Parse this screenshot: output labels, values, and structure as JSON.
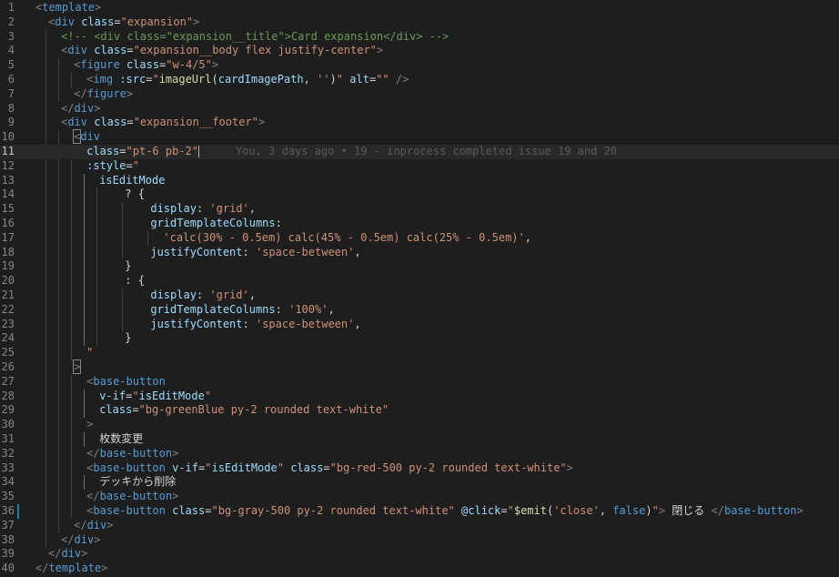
{
  "editor": {
    "lines": [
      {
        "n": "1",
        "segments": [
          [
            "br",
            "<"
          ],
          [
            "tag",
            "template"
          ],
          [
            "br",
            ">"
          ]
        ]
      },
      {
        "n": "2",
        "segments": [
          [
            "br",
            "<"
          ],
          [
            "tag",
            "div"
          ],
          [
            "txt",
            " "
          ],
          [
            "attr",
            "class"
          ],
          [
            "txt",
            "="
          ],
          [
            "str",
            "\"expansion\""
          ],
          [
            "br",
            ">"
          ]
        ]
      },
      {
        "n": "3",
        "segments": [
          [
            "cmt",
            "<!-- <div class=\"expansion__title\">Card expansion</div> -->"
          ]
        ]
      },
      {
        "n": "4",
        "segments": [
          [
            "br",
            "<"
          ],
          [
            "tag",
            "div"
          ],
          [
            "txt",
            " "
          ],
          [
            "attr",
            "class"
          ],
          [
            "txt",
            "="
          ],
          [
            "str",
            "\"expansion__body flex justify-center\""
          ],
          [
            "br",
            ">"
          ]
        ]
      },
      {
        "n": "5",
        "segments": [
          [
            "br",
            "<"
          ],
          [
            "tag",
            "figure"
          ],
          [
            "txt",
            " "
          ],
          [
            "attr",
            "class"
          ],
          [
            "txt",
            "="
          ],
          [
            "str",
            "\"w-4/5\""
          ],
          [
            "br",
            ">"
          ]
        ]
      },
      {
        "n": "6",
        "segments": [
          [
            "br",
            "<"
          ],
          [
            "tag",
            "img"
          ],
          [
            "txt",
            " "
          ],
          [
            "attr",
            ":src"
          ],
          [
            "txt",
            "="
          ],
          [
            "str",
            "\""
          ],
          [
            "fn",
            "imageUrl"
          ],
          [
            "txt",
            "("
          ],
          [
            "key",
            "cardImagePath"
          ],
          [
            "txt",
            ", "
          ],
          [
            "str",
            "''"
          ],
          [
            "txt",
            ")"
          ],
          [
            "str",
            "\""
          ],
          [
            "txt",
            " "
          ],
          [
            "attr",
            "alt"
          ],
          [
            "txt",
            "="
          ],
          [
            "str",
            "\"\""
          ],
          [
            "txt",
            " "
          ],
          [
            "br",
            "/>"
          ]
        ]
      },
      {
        "n": "7",
        "segments": [
          [
            "br",
            "</"
          ],
          [
            "tag",
            "figure"
          ],
          [
            "br",
            ">"
          ]
        ]
      },
      {
        "n": "8",
        "segments": [
          [
            "br",
            "</"
          ],
          [
            "tag",
            "div"
          ],
          [
            "br",
            ">"
          ]
        ]
      },
      {
        "n": "9",
        "segments": [
          [
            "br",
            "<"
          ],
          [
            "tag",
            "div"
          ],
          [
            "txt",
            " "
          ],
          [
            "attr",
            "class"
          ],
          [
            "txt",
            "="
          ],
          [
            "str",
            "\"expansion__footer\""
          ],
          [
            "br",
            ">"
          ]
        ]
      },
      {
        "n": "10",
        "segments": [
          [
            "br",
            "<"
          ],
          [
            "tag",
            "div"
          ]
        ]
      },
      {
        "n": "11",
        "segments": [
          [
            "attr",
            "class"
          ],
          [
            "txt",
            "="
          ],
          [
            "str",
            "\"pt-6 pb-2\""
          ]
        ],
        "blame": "You, 3 days ago • 19 - inprocess completed issue 19 and 20"
      },
      {
        "n": "12",
        "segments": [
          [
            "attr",
            ":style"
          ],
          [
            "txt",
            "="
          ],
          [
            "str",
            "\""
          ]
        ]
      },
      {
        "n": "13",
        "segments": [
          [
            "key",
            "isEditMode"
          ]
        ]
      },
      {
        "n": "14",
        "segments": [
          [
            "txt",
            "? {"
          ]
        ]
      },
      {
        "n": "15",
        "segments": [
          [
            "key",
            "display"
          ],
          [
            "txt",
            ": "
          ],
          [
            "str",
            "'grid'"
          ],
          [
            "txt",
            ","
          ]
        ]
      },
      {
        "n": "16",
        "segments": [
          [
            "key",
            "gridTemplateColumns"
          ],
          [
            "txt",
            ":"
          ]
        ]
      },
      {
        "n": "17",
        "segments": [
          [
            "str",
            "'calc(30% - 0.5em) calc(45% - 0.5em) calc(25% - 0.5em)'"
          ],
          [
            "txt",
            ","
          ]
        ]
      },
      {
        "n": "18",
        "segments": [
          [
            "key",
            "justifyContent"
          ],
          [
            "txt",
            ": "
          ],
          [
            "str",
            "'space-between'"
          ],
          [
            "txt",
            ","
          ]
        ]
      },
      {
        "n": "19",
        "segments": [
          [
            "txt",
            "}"
          ]
        ]
      },
      {
        "n": "20",
        "segments": [
          [
            "txt",
            ": {"
          ]
        ]
      },
      {
        "n": "21",
        "segments": [
          [
            "key",
            "display"
          ],
          [
            "txt",
            ": "
          ],
          [
            "str",
            "'grid'"
          ],
          [
            "txt",
            ","
          ]
        ]
      },
      {
        "n": "22",
        "segments": [
          [
            "key",
            "gridTemplateColumns"
          ],
          [
            "txt",
            ": "
          ],
          [
            "str",
            "'100%'"
          ],
          [
            "txt",
            ","
          ]
        ]
      },
      {
        "n": "23",
        "segments": [
          [
            "key",
            "justifyContent"
          ],
          [
            "txt",
            ": "
          ],
          [
            "str",
            "'space-between'"
          ],
          [
            "txt",
            ","
          ]
        ]
      },
      {
        "n": "24",
        "segments": [
          [
            "txt",
            "}"
          ]
        ]
      },
      {
        "n": "25",
        "segments": [
          [
            "str",
            "\""
          ]
        ]
      },
      {
        "n": "26",
        "segments": [
          [
            "br",
            ">"
          ]
        ]
      },
      {
        "n": "27",
        "segments": [
          [
            "br",
            "<"
          ],
          [
            "tag",
            "base-button"
          ]
        ]
      },
      {
        "n": "28",
        "segments": [
          [
            "attr",
            "v-if"
          ],
          [
            "txt",
            "="
          ],
          [
            "str",
            "\""
          ],
          [
            "key",
            "isEditMode"
          ],
          [
            "str",
            "\""
          ]
        ]
      },
      {
        "n": "29",
        "segments": [
          [
            "attr",
            "class"
          ],
          [
            "txt",
            "="
          ],
          [
            "str",
            "\"bg-greenBlue py-2 rounded text-white\""
          ]
        ]
      },
      {
        "n": "30",
        "segments": [
          [
            "br",
            ">"
          ]
        ]
      },
      {
        "n": "31",
        "segments": [
          [
            "txt",
            "枚数変更"
          ]
        ]
      },
      {
        "n": "32",
        "segments": [
          [
            "br",
            "</"
          ],
          [
            "tag",
            "base-button"
          ],
          [
            "br",
            ">"
          ]
        ]
      },
      {
        "n": "33",
        "segments": [
          [
            "br",
            "<"
          ],
          [
            "tag",
            "base-button"
          ],
          [
            "txt",
            " "
          ],
          [
            "attr",
            "v-if"
          ],
          [
            "txt",
            "="
          ],
          [
            "str",
            "\""
          ],
          [
            "key",
            "isEditMode"
          ],
          [
            "str",
            "\""
          ],
          [
            "txt",
            " "
          ],
          [
            "attr",
            "class"
          ],
          [
            "txt",
            "="
          ],
          [
            "str",
            "\"bg-red-500 py-2 rounded text-white\""
          ],
          [
            "br",
            ">"
          ]
        ]
      },
      {
        "n": "34",
        "segments": [
          [
            "txt",
            "デッキから削除"
          ]
        ]
      },
      {
        "n": "35",
        "segments": [
          [
            "br",
            "</"
          ],
          [
            "tag",
            "base-button"
          ],
          [
            "br",
            ">"
          ]
        ]
      },
      {
        "n": "36",
        "segments": [
          [
            "br",
            "<"
          ],
          [
            "tag",
            "base-button"
          ],
          [
            "txt",
            " "
          ],
          [
            "attr",
            "class"
          ],
          [
            "txt",
            "="
          ],
          [
            "str",
            "\"bg-gray-500 py-2 rounded text-white\""
          ],
          [
            "txt",
            " "
          ],
          [
            "attr",
            "@click"
          ],
          [
            "txt",
            "="
          ],
          [
            "str",
            "\""
          ],
          [
            "fn",
            "$emit"
          ],
          [
            "txt",
            "("
          ],
          [
            "str",
            "'close'"
          ],
          [
            "txt",
            ", "
          ],
          [
            "kw",
            "false"
          ],
          [
            "txt",
            ")"
          ],
          [
            "str",
            "\""
          ],
          [
            "br",
            ">"
          ],
          [
            "txt",
            " 閉じる "
          ],
          [
            "br",
            "</"
          ],
          [
            "tag",
            "base-button"
          ],
          [
            "br",
            ">"
          ]
        ]
      },
      {
        "n": "37",
        "segments": [
          [
            "br",
            "</"
          ],
          [
            "tag",
            "div"
          ],
          [
            "br",
            ">"
          ]
        ]
      },
      {
        "n": "38",
        "segments": [
          [
            "br",
            "</"
          ],
          [
            "tag",
            "div"
          ],
          [
            "br",
            ">"
          ]
        ]
      },
      {
        "n": "39",
        "segments": [
          [
            "br",
            "</"
          ],
          [
            "tag",
            "div"
          ],
          [
            "br",
            ">"
          ]
        ]
      },
      {
        "n": "40",
        "segments": [
          [
            "br",
            "</"
          ],
          [
            "tag",
            "template"
          ],
          [
            "br",
            ">"
          ]
        ]
      }
    ]
  }
}
